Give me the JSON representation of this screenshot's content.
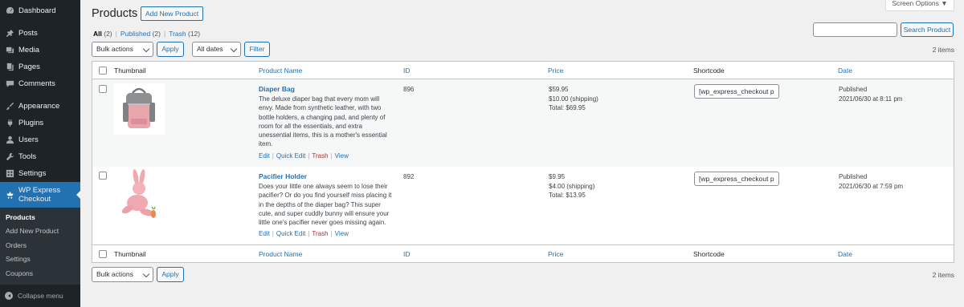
{
  "sidebar": {
    "items": [
      {
        "label": "Dashboard",
        "icon": "dashboard-icon"
      },
      {
        "label": "Posts",
        "icon": "pin-icon"
      },
      {
        "label": "Media",
        "icon": "media-icon"
      },
      {
        "label": "Pages",
        "icon": "pages-icon"
      },
      {
        "label": "Comments",
        "icon": "comment-icon"
      },
      {
        "label": "Appearance",
        "icon": "brush-icon"
      },
      {
        "label": "Plugins",
        "icon": "plugin-icon"
      },
      {
        "label": "Users",
        "icon": "user-icon"
      },
      {
        "label": "Tools",
        "icon": "wrench-icon"
      },
      {
        "label": "Settings",
        "icon": "settings-icon"
      }
    ],
    "active": {
      "label_line1": "WP Express",
      "label_line2": "Checkout",
      "icon": "cart-icon"
    },
    "submenu": [
      "Products",
      "Add New Product",
      "Orders",
      "Settings",
      "Coupons"
    ],
    "collapse_label": "Collapse menu"
  },
  "header": {
    "title": "Products",
    "add_new_label": "Add New Product",
    "screen_options_label": "Screen Options ▼"
  },
  "filters": {
    "all_label": "All",
    "all_count": "(2)",
    "published_label": "Published",
    "published_count": "(2)",
    "trash_label": "Trash",
    "trash_count": "(12)",
    "sep": "|"
  },
  "search": {
    "placeholder": "",
    "button_label": "Search Product"
  },
  "toolbar": {
    "bulk_actions": "Bulk actions",
    "apply": "Apply",
    "dates": "All dates",
    "filter": "Filter",
    "items_count": "2 items"
  },
  "table": {
    "columns": [
      "Thumbnail",
      "Product Name",
      "ID",
      "Price",
      "Shortcode",
      "Date"
    ],
    "rows": [
      {
        "name": "Diaper Bag",
        "description": "The deluxe diaper bag that every mom will envy. Made from synthetic leather, with two bottle holders, a changing pad, and plenty of room for all the essentials, and extra unessential items, this is a mother's essential item.",
        "id": "896",
        "price": "$59.95",
        "shipping": "$10.00 (shipping)",
        "total": "Total: $69.95",
        "shortcode": "[wp_express_checkout p",
        "status": "Published",
        "date": "2021/06/30 at 8:11 pm"
      },
      {
        "name": "Pacifier Holder",
        "description": "Does your little one always seem to lose their pacifier? Or do you find yourself miss placing it in the depths of the diaper bag? This super cute, and super cuddly bunny will ensure your little one's pacifier never goes missing again.",
        "id": "892",
        "price": "$9.95",
        "shipping": "$4.00 (shipping)",
        "total": "Total: $13.95",
        "shortcode": "[wp_express_checkout p",
        "status": "Published",
        "date": "2021/06/30 at 7:59 pm"
      }
    ],
    "row_actions": {
      "edit": "Edit",
      "quick_edit": "Quick Edit",
      "trash": "Trash",
      "view": "View",
      "sep": "|"
    }
  },
  "colors": {
    "sidebar_bg": "#1d2327",
    "accent": "#2271b1",
    "trash": "#b32d2e",
    "page_bg": "#f0f0f1"
  }
}
